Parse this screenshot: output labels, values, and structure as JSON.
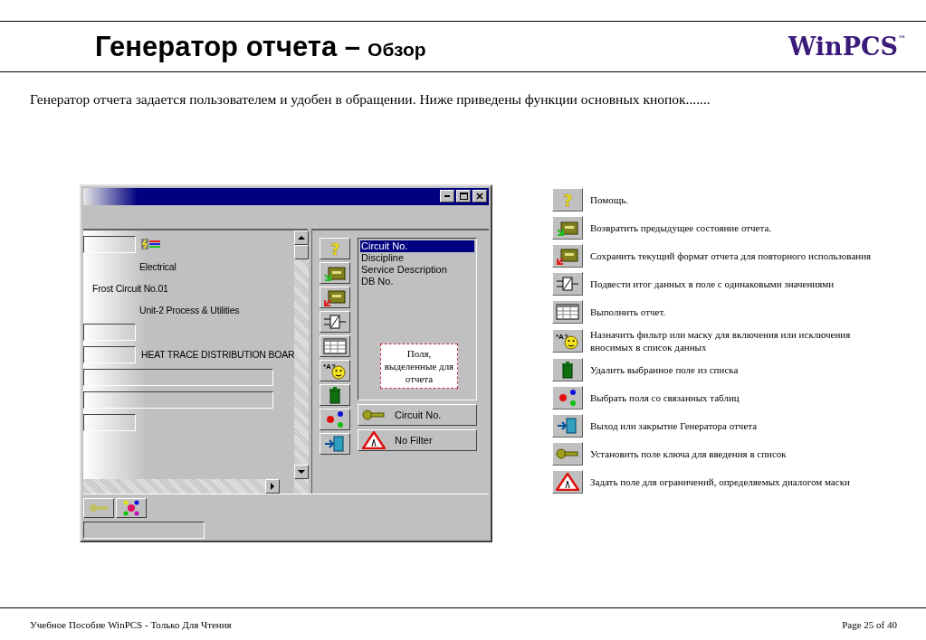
{
  "header": {
    "title": "Генератор отчета –",
    "subtitle": "Обзор",
    "logo": "WinPCS",
    "logo_mark": "™"
  },
  "intro": "Генератор отчета задается пользователем и удобен в обращении. Ниже приведены функции основных кнопок.......",
  "window": {
    "form": [
      {
        "kind": "field-icon"
      },
      {
        "kind": "label",
        "text": "Electrical"
      },
      {
        "kind": "text",
        "text": "Frost Circuit No.01"
      },
      {
        "kind": "label",
        "text": "Unit-2 Process & Utilities"
      },
      {
        "kind": "field"
      },
      {
        "kind": "field-label",
        "text": "HEAT TRACE DISTRIBUTION BOAR"
      },
      {
        "kind": "wide-field"
      },
      {
        "kind": "wide-field"
      },
      {
        "kind": "field"
      }
    ],
    "tools": [
      {
        "kind": "help",
        "glyph": "?"
      },
      {
        "kind": "restore"
      },
      {
        "kind": "save"
      },
      {
        "kind": "summary"
      },
      {
        "kind": "run"
      },
      {
        "kind": "filter",
        "glyph": "*A?"
      },
      {
        "kind": "delete"
      },
      {
        "kind": "link"
      },
      {
        "kind": "exit"
      }
    ],
    "field_list": [
      {
        "label": "Circuit No.",
        "selected": true
      },
      {
        "label": "Discipline",
        "selected": false
      },
      {
        "label": "Service Description",
        "selected": false
      },
      {
        "label": "DB No.",
        "selected": false
      }
    ],
    "note": "Поля, выделенные для отчета",
    "key_button": "Circuit No.",
    "filter_button": "No Filter"
  },
  "legend": [
    {
      "kind": "help",
      "glyph": "?",
      "text": "Помощь."
    },
    {
      "kind": "restore",
      "text": "Возвратить предыдущее состояние отчета."
    },
    {
      "kind": "save",
      "text": "Сохранить текущий формат отчета для повторного использования"
    },
    {
      "kind": "summary",
      "text": "Подвести итог данных в поле с одинаковыми значениями"
    },
    {
      "kind": "run",
      "text": "Выполнить отчет."
    },
    {
      "kind": "filter",
      "glyph": "*A?",
      "text": "Назначить фильтр или маску для включения или исключения вносимых в список данных"
    },
    {
      "kind": "delete",
      "text": "Удалить выбранное поле из списка"
    },
    {
      "kind": "link",
      "text": "Выбрать поля со связанных таблиц"
    },
    {
      "kind": "exit",
      "text": "Выход или закрытие Генератора отчета"
    },
    {
      "kind": "key",
      "text": "Установить поле ключа для введения в список"
    },
    {
      "kind": "limit",
      "text": "Задать поле для ограничений, определяемых диалогом маски"
    }
  ],
  "footer": {
    "left": "Учебное Пособие WinPCS - Только Для Чтения",
    "right": "Page 25 of 40"
  }
}
